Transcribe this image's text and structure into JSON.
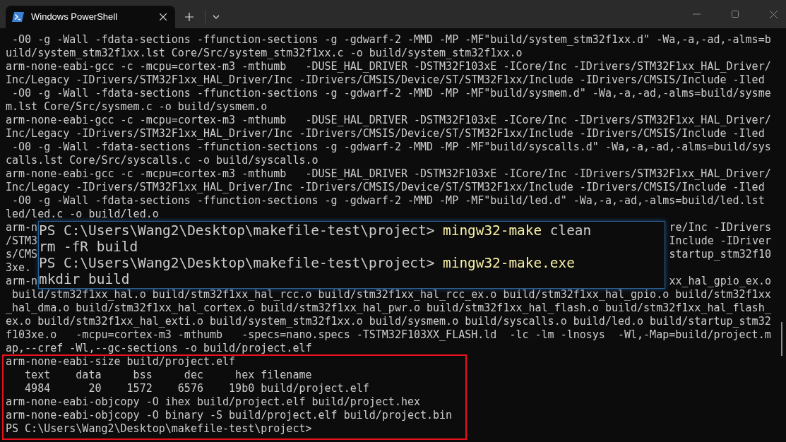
{
  "tab": {
    "title": "Windows PowerShell",
    "selected": true
  },
  "terminal": {
    "lines": [
      {
        "kind": "line",
        "text": " -O0 -g -Wall -fdata-sections -ffunction-sections -g -gdwarf-2 -MMD -MP -MF\"build/system_stm32f1xx.d\" -Wa,-a,-ad,-alms=b"
      },
      {
        "kind": "line",
        "text": "uild/system_stm32f1xx.lst Core/Src/system_stm32f1xx.c -o build/system_stm32f1xx.o"
      },
      {
        "kind": "line",
        "text": "arm-none-eabi-gcc -c -mcpu=cortex-m3 -mthumb   -DUSE_HAL_DRIVER -DSTM32F103xE -ICore/Inc -IDrivers/STM32F1xx_HAL_Driver/"
      },
      {
        "kind": "line",
        "text": "Inc/Legacy -IDrivers/STM32F1xx_HAL_Driver/Inc -IDrivers/CMSIS/Device/ST/STM32F1xx/Include -IDrivers/CMSIS/Include -Iled"
      },
      {
        "kind": "line",
        "text": " -O0 -g -Wall -fdata-sections -ffunction-sections -g -gdwarf-2 -MMD -MP -MF\"build/sysmem.d\" -Wa,-a,-ad,-alms=build/sysme"
      },
      {
        "kind": "line",
        "text": "m.lst Core/Src/sysmem.c -o build/sysmem.o"
      },
      {
        "kind": "line",
        "text": "arm-none-eabi-gcc -c -mcpu=cortex-m3 -mthumb   -DUSE_HAL_DRIVER -DSTM32F103xE -ICore/Inc -IDrivers/STM32F1xx_HAL_Driver/"
      },
      {
        "kind": "line",
        "text": "Inc/Legacy -IDrivers/STM32F1xx_HAL_Driver/Inc -IDrivers/CMSIS/Device/ST/STM32F1xx/Include -IDrivers/CMSIS/Include -Iled"
      },
      {
        "kind": "line",
        "text": " -O0 -g -Wall -fdata-sections -ffunction-sections -g -gdwarf-2 -MMD -MP -MF\"build/syscalls.d\" -Wa,-a,-ad,-alms=build/sys"
      },
      {
        "kind": "line",
        "text": "calls.lst Core/Src/syscalls.c -o build/syscalls.o"
      },
      {
        "kind": "line",
        "text": "arm-none-eabi-gcc -c -mcpu=cortex-m3 -mthumb   -DUSE_HAL_DRIVER -DSTM32F103xE -ICore/Inc -IDrivers/STM32F1xx_HAL_Driver/"
      },
      {
        "kind": "line",
        "text": "Inc/Legacy -IDrivers/STM32F1xx_HAL_Driver/Inc -IDrivers/CMSIS/Device/ST/STM32F1xx/Include -IDrivers/CMSIS/Include -Iled"
      },
      {
        "kind": "line",
        "text": " -O0 -g -Wall -fdata-sections -ffunction-sections -g -gdwarf-2 -MMD -MP -MF\"build/led.d\" -Wa,-a,-ad,-alms=build/led.lst"
      },
      {
        "kind": "line",
        "text": "led/led.c -o build/led.o"
      },
      {
        "kind": "split",
        "left": "arm-n",
        "right": "re/Inc -IDrivers"
      },
      {
        "kind": "split",
        "left": "/STM3",
        "right": "Include -IDriver"
      },
      {
        "kind": "split",
        "left": "s/CMS",
        "right": "startup_stm32f10"
      },
      {
        "kind": "split",
        "left": "3xe."
      },
      {
        "kind": "split",
        "left": "arm-n",
        "right": "xx_hal_gpio_ex.o"
      },
      {
        "kind": "line",
        "text": " build/stm32f1xx_hal.o build/stm32f1xx_hal_rcc.o build/stm32f1xx_hal_rcc_ex.o build/stm32f1xx_hal_gpio.o build/stm32f1xx"
      },
      {
        "kind": "line",
        "text": "_hal_dma.o build/stm32f1xx_hal_cortex.o build/stm32f1xx_hal_pwr.o build/stm32f1xx_hal_flash.o build/stm32f1xx_hal_flash_"
      },
      {
        "kind": "line",
        "text": "ex.o build/stm32f1xx_hal_exti.o build/system_stm32f1xx.o build/sysmem.o build/syscalls.o build/led.o build/startup_stm32"
      },
      {
        "kind": "line",
        "text": "f103xe.o   -mcpu=cortex-m3 -mthumb   -specs=nano.specs -TSTM32F103XX_FLASH.ld  -lc -lm -lnosys  -Wl,-Map=build/project.m"
      },
      {
        "kind": "line",
        "text": "ap,--cref -Wl,--gc-sections -o build/project.elf"
      },
      {
        "kind": "line",
        "text": "arm-none-eabi-size build/project.elf"
      },
      {
        "kind": "line",
        "text": "   text    data     bss     dec     hex filename"
      },
      {
        "kind": "line",
        "text": "   4984      20    1572    6576    19b0 build/project.elf"
      },
      {
        "kind": "line",
        "text": "arm-none-eabi-objcopy -O ihex build/project.elf build/project.hex"
      },
      {
        "kind": "line",
        "text": "arm-none-eabi-objcopy -O binary -S build/project.elf build/project.bin"
      },
      {
        "kind": "line",
        "text": "PS C:\\Users\\Wang2\\Desktop\\makefile-test\\project>"
      }
    ]
  },
  "popup": {
    "lines": [
      {
        "segments": [
          {
            "kind": "prompt",
            "text": "PS C:\\Users\\Wang2\\Desktop\\makefile-test\\project>"
          },
          {
            "kind": "command",
            "text": "mingw32-make"
          },
          {
            "kind": "arg",
            "text": "clean"
          }
        ]
      },
      {
        "segments": [
          {
            "kind": "output",
            "text": "rm -fR build"
          }
        ]
      },
      {
        "segments": [
          {
            "kind": "prompt",
            "text": "PS C:\\Users\\Wang2\\Desktop\\makefile-test\\project>"
          },
          {
            "kind": "command",
            "text": "mingw32-make.exe"
          }
        ]
      },
      {
        "segments": [
          {
            "kind": "output",
            "text": "mkdir build"
          }
        ]
      }
    ]
  }
}
